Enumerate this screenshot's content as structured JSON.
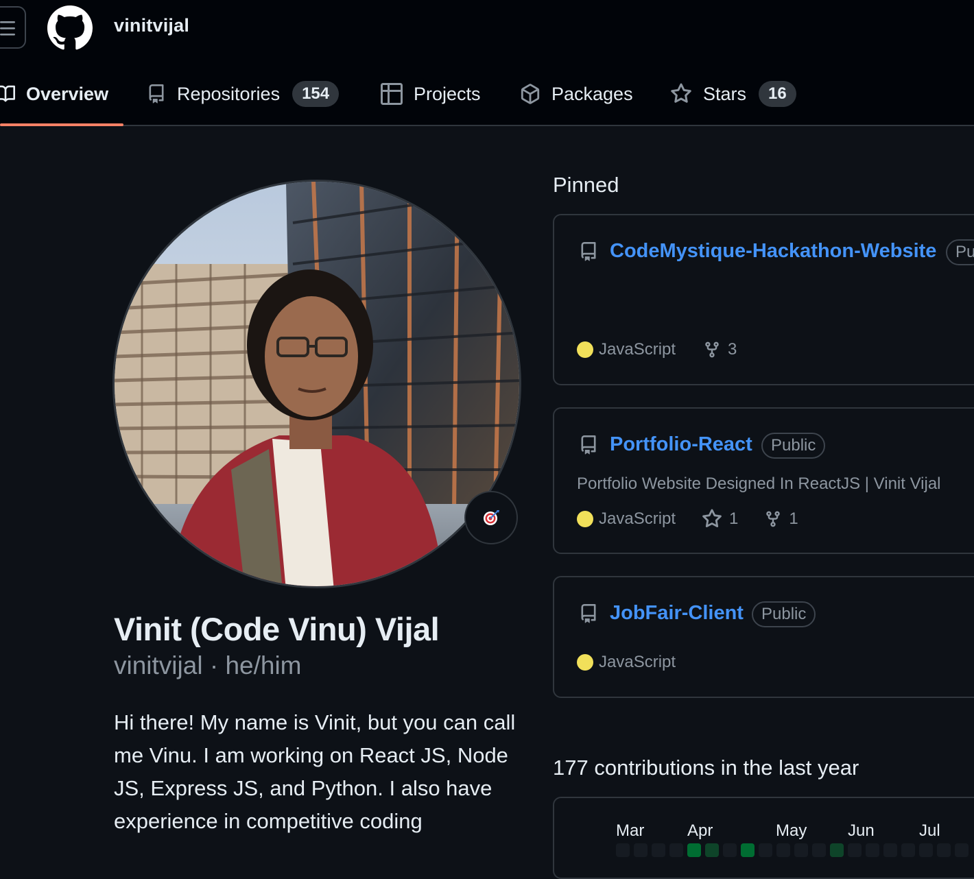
{
  "header": {
    "owner_name": "vinitvijal",
    "menu_icon": "hamburger-icon",
    "logo_icon": "github-mark-icon"
  },
  "tabs": [
    {
      "label": "Overview",
      "icon": "book-icon",
      "active": true
    },
    {
      "label": "Repositories",
      "icon": "repo-icon",
      "count": "154"
    },
    {
      "label": "Projects",
      "icon": "table-icon"
    },
    {
      "label": "Packages",
      "icon": "package-icon"
    },
    {
      "label": "Stars",
      "icon": "star-icon",
      "count": "16"
    }
  ],
  "profile": {
    "full_name": "Vinit (Code Vinu) Vijal",
    "login": "vinitvijal",
    "separator": "·",
    "pronouns": "he/him",
    "status_emoji": "🎯",
    "bio": "Hi there! My name is Vinit, but you can call me Vinu. I am working on React JS, Node JS, Express JS, and Python. I also have experience in competitive coding"
  },
  "pinned": {
    "title": "Pinned",
    "repos": [
      {
        "name": "CodeMystique-Hackathon-Website",
        "visibility": "Pu",
        "description": "",
        "language": "JavaScript",
        "language_color": "#f1e05a",
        "forks": "3"
      },
      {
        "name": "Portfolio-React",
        "visibility": "Public",
        "description": "Portfolio Website Designed In ReactJS | Vinit Vijal",
        "language": "JavaScript",
        "language_color": "#f1e05a",
        "stars": "1",
        "forks": "1"
      },
      {
        "name": "JobFair-Client",
        "visibility": "Public",
        "description": "",
        "language": "JavaScript",
        "language_color": "#f1e05a"
      }
    ]
  },
  "contributions": {
    "title": "177 contributions in the last year",
    "months": [
      "Mar",
      "Apr",
      "May",
      "Jun",
      "Jul"
    ]
  },
  "colors": {
    "accent_underline": "#f78166",
    "link": "#4493f8",
    "javascript": "#f1e05a"
  }
}
